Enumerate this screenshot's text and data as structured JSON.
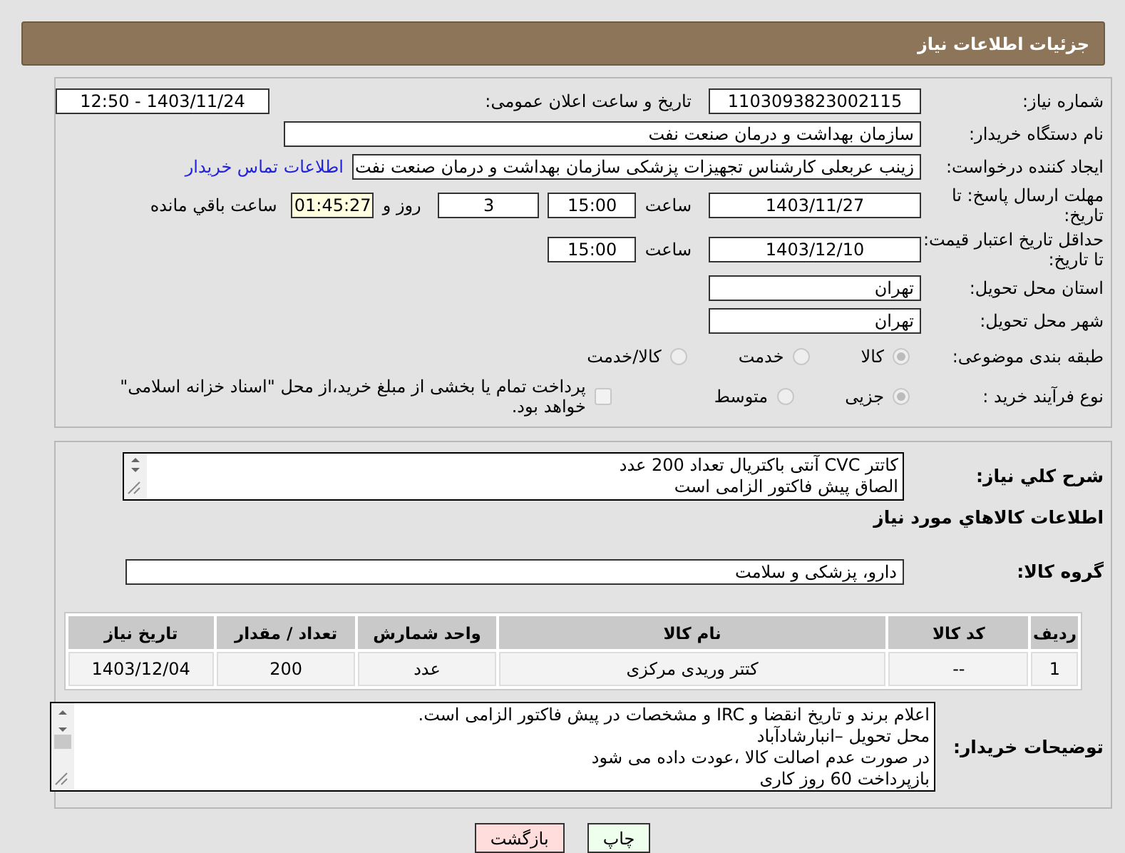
{
  "header": {
    "title": "جزئیات اطلاعات نیاز"
  },
  "need_number": {
    "label": "شماره نیاز:",
    "value": "1103093823002115"
  },
  "announce": {
    "label": "تاریخ و ساعت اعلان عمومی:",
    "value": "1403/11/24 - 12:50"
  },
  "buyer": {
    "label": "نام دستگاه خریدار:",
    "value": "سازمان بهداشت و درمان صنعت نفت"
  },
  "creator": {
    "label": "ایجاد کننده درخواست:",
    "value": "زینب عربعلی کارشناس تجهیزات پزشکی سازمان بهداشت و درمان صنعت نفت",
    "link": "اطلاعات تماس خریدار"
  },
  "deadline": {
    "label": "مهلت ارسال پاسخ: تا تاریخ:",
    "date": "1403/11/27",
    "time_label": "ساعت",
    "time": "15:00",
    "days": "3",
    "days_label": "روز و",
    "remaining": "01:45:27",
    "remaining_label": "ساعت باقي مانده"
  },
  "validity": {
    "label": "حداقل تاریخ اعتبار قیمت: تا تاریخ:",
    "date": "1403/12/10",
    "time_label": "ساعت",
    "time": "15:00"
  },
  "province": {
    "label": "استان محل تحویل:",
    "value": "تهران"
  },
  "city": {
    "label": "شهر محل تحویل:",
    "value": "تهران"
  },
  "category": {
    "label": "طبقه بندی موضوعی:",
    "options": [
      {
        "label": "کالا",
        "selected": true
      },
      {
        "label": "خدمت",
        "selected": false
      },
      {
        "label": "کالا/خدمت",
        "selected": false
      }
    ]
  },
  "process": {
    "label": "نوع فرآیند خرید :",
    "options": [
      {
        "label": "جزیی",
        "selected": true
      },
      {
        "label": "متوسط",
        "selected": false
      }
    ],
    "payment": {
      "checked": false,
      "text": "پرداخت تمام یا بخشی از مبلغ خرید،از محل \"اسناد خزانه اسلامی\" خواهد بود."
    }
  },
  "description": {
    "label": "شرح کلي نياز:",
    "lines": [
      "کاتتر CVC آنتی باکتریال تعداد 200 عدد",
      "الصاق پیش فاکتور الزامی است"
    ]
  },
  "goods_title": "اطلاعات کالاهاي مورد نياز",
  "group": {
    "label": "گروه کالا:",
    "value": "دارو، پزشکی و سلامت"
  },
  "table": {
    "columns": [
      "ردیف",
      "کد کالا",
      "نام کالا",
      "واحد شمارش",
      "تعداد / مقدار",
      "تاریخ نیاز"
    ],
    "rows": [
      [
        "1",
        "--",
        "کتتر وریدی مرکزی",
        "عدد",
        "200",
        "1403/12/04"
      ]
    ]
  },
  "buyer_notes": {
    "label": "توضیحات خریدار:",
    "lines": [
      "اعلام برند و تاریخ انقضا  و IRC  و مشخصات  در پیش فاکتور الزامی است.",
      "محل تحویل –انبارشادآباد",
      "در صورت عدم اصالت کالا ،عودت داده می شود",
      "بازپرداخت 60 روز کاری"
    ]
  },
  "buttons": [
    {
      "label": "چاپ",
      "kind": "print"
    },
    {
      "label": "بازگشت",
      "kind": "back"
    }
  ]
}
